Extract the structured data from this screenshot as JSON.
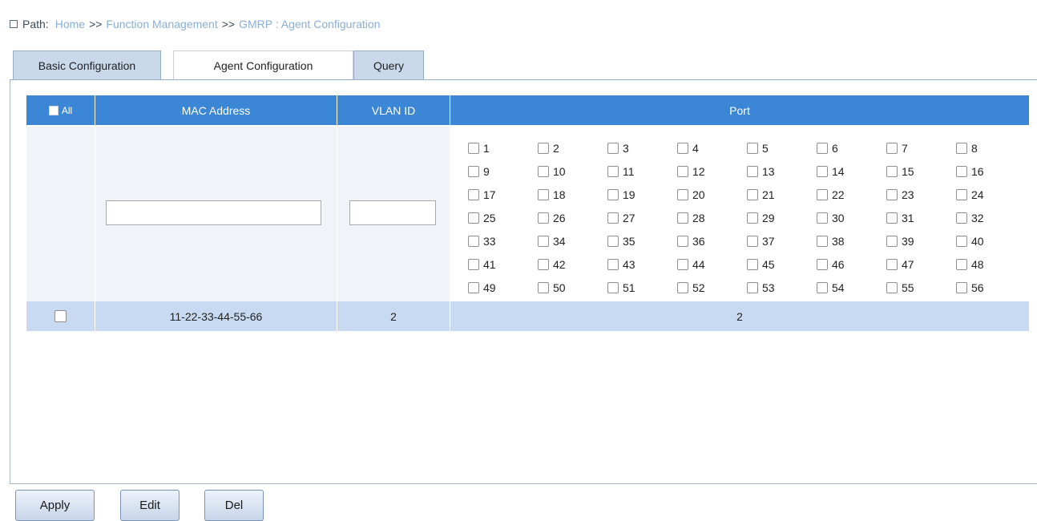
{
  "path": {
    "label": "Path:",
    "crumbs": [
      "Home",
      "Function Management",
      "GMRP : Agent Configuration"
    ],
    "separator": ">>"
  },
  "tabs": [
    {
      "label": "Basic Configuration",
      "active": false
    },
    {
      "label": "Agent Configuration",
      "active": true
    },
    {
      "label": "Query",
      "active": false
    }
  ],
  "table": {
    "headers": {
      "all": "All",
      "mac": "MAC Address",
      "vlan": "VLAN ID",
      "port": "Port"
    },
    "inputs": {
      "mac_value": "",
      "vlan_value": ""
    },
    "ports": [
      "1",
      "2",
      "3",
      "4",
      "5",
      "6",
      "7",
      "8",
      "9",
      "10",
      "11",
      "12",
      "13",
      "14",
      "15",
      "16",
      "17",
      "18",
      "19",
      "20",
      "21",
      "22",
      "23",
      "24",
      "25",
      "26",
      "27",
      "28",
      "29",
      "30",
      "31",
      "32",
      "33",
      "34",
      "35",
      "36",
      "37",
      "38",
      "39",
      "40",
      "41",
      "42",
      "43",
      "44",
      "45",
      "46",
      "47",
      "48",
      "49",
      "50",
      "51",
      "52",
      "53",
      "54",
      "55",
      "56"
    ],
    "rows": [
      {
        "mac": "11-22-33-44-55-66",
        "vlan": "2",
        "port": "2"
      }
    ]
  },
  "buttons": {
    "apply": "Apply",
    "edit": "Edit",
    "del": "Del"
  },
  "colors": {
    "header_bg": "#3b87d6",
    "row_bg": "#c8daf2",
    "tab_inactive": "#c9d8ea",
    "link": "#8aaed6"
  }
}
